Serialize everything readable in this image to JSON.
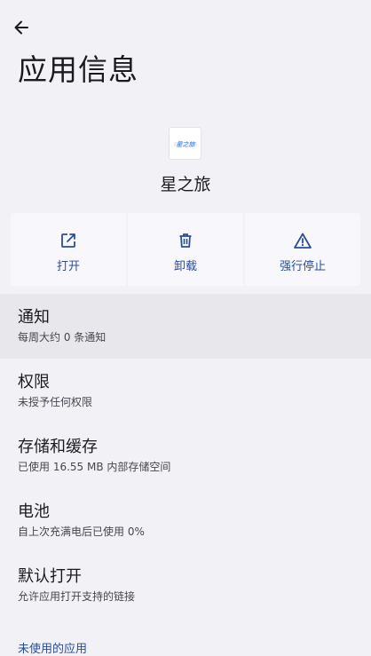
{
  "header": {
    "back_icon": "arrow-left-icon",
    "title": "应用信息"
  },
  "app": {
    "name": "星之旅",
    "icon_text": "星之旅",
    "icon_color": "#2a6fd6"
  },
  "actions": [
    {
      "label": "打开",
      "icon": "open-external-icon"
    },
    {
      "label": "卸载",
      "icon": "trash-icon"
    },
    {
      "label": "强行停止",
      "icon": "warning-icon"
    }
  ],
  "items": [
    {
      "title": "通知",
      "subtitle": "每周大约 0 条通知"
    },
    {
      "title": "权限",
      "subtitle": "未授予任何权限"
    },
    {
      "title": "存储和缓存",
      "subtitle": "已使用 16.55 MB 内部存储空间"
    },
    {
      "title": "电池",
      "subtitle": "自上次充满电后已使用 0%"
    },
    {
      "title": "默认打开",
      "subtitle": "允许应用打开支持的链接"
    }
  ],
  "section": {
    "label": "未使用的应用"
  },
  "colors": {
    "accent": "#2a4d9a",
    "background": "#f1f1f6",
    "card": "#f8f8fc"
  }
}
